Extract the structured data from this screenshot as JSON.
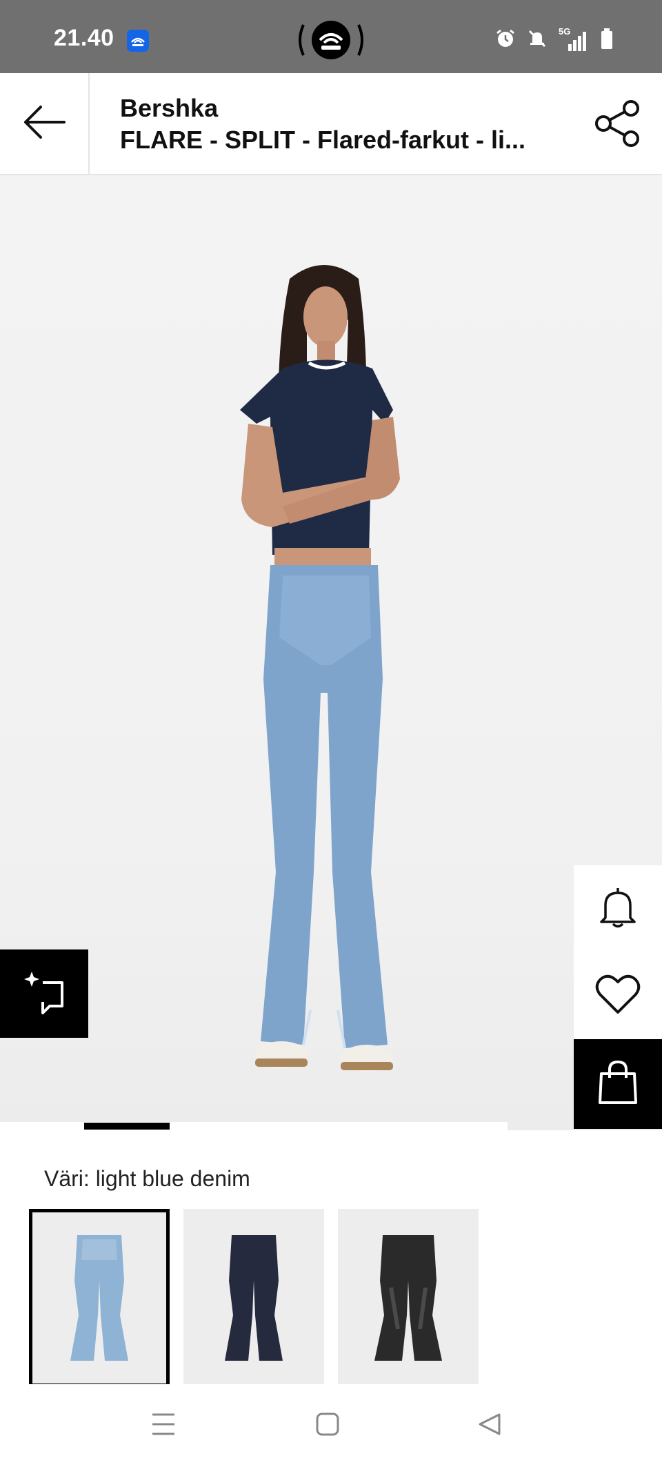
{
  "status_bar": {
    "time": "21.40",
    "network": "5G"
  },
  "header": {
    "brand": "Bershka",
    "product_title": "FLARE - SPLIT - Flared-farkut - li..."
  },
  "hero": {
    "image_count": 6,
    "active_image": 2
  },
  "colors": {
    "label": "Väri: light blue denim",
    "options": [
      {
        "name": "light blue denim",
        "hex": "#8fb3d4",
        "selected": true
      },
      {
        "name": "dark blue",
        "hex": "#252a3e",
        "selected": false
      },
      {
        "name": "black",
        "hex": "#2a2a2a",
        "selected": false
      }
    ]
  },
  "icons": {
    "back": "arrow-left-icon",
    "share": "share-icon",
    "notify": "bell-icon",
    "wishlist": "heart-icon",
    "bag": "shopping-bag-icon",
    "similar": "sparkle-similar-icon"
  },
  "theme": {
    "accent": "#000000",
    "status_bar": "#707070",
    "app_badge": "#1565e8"
  }
}
